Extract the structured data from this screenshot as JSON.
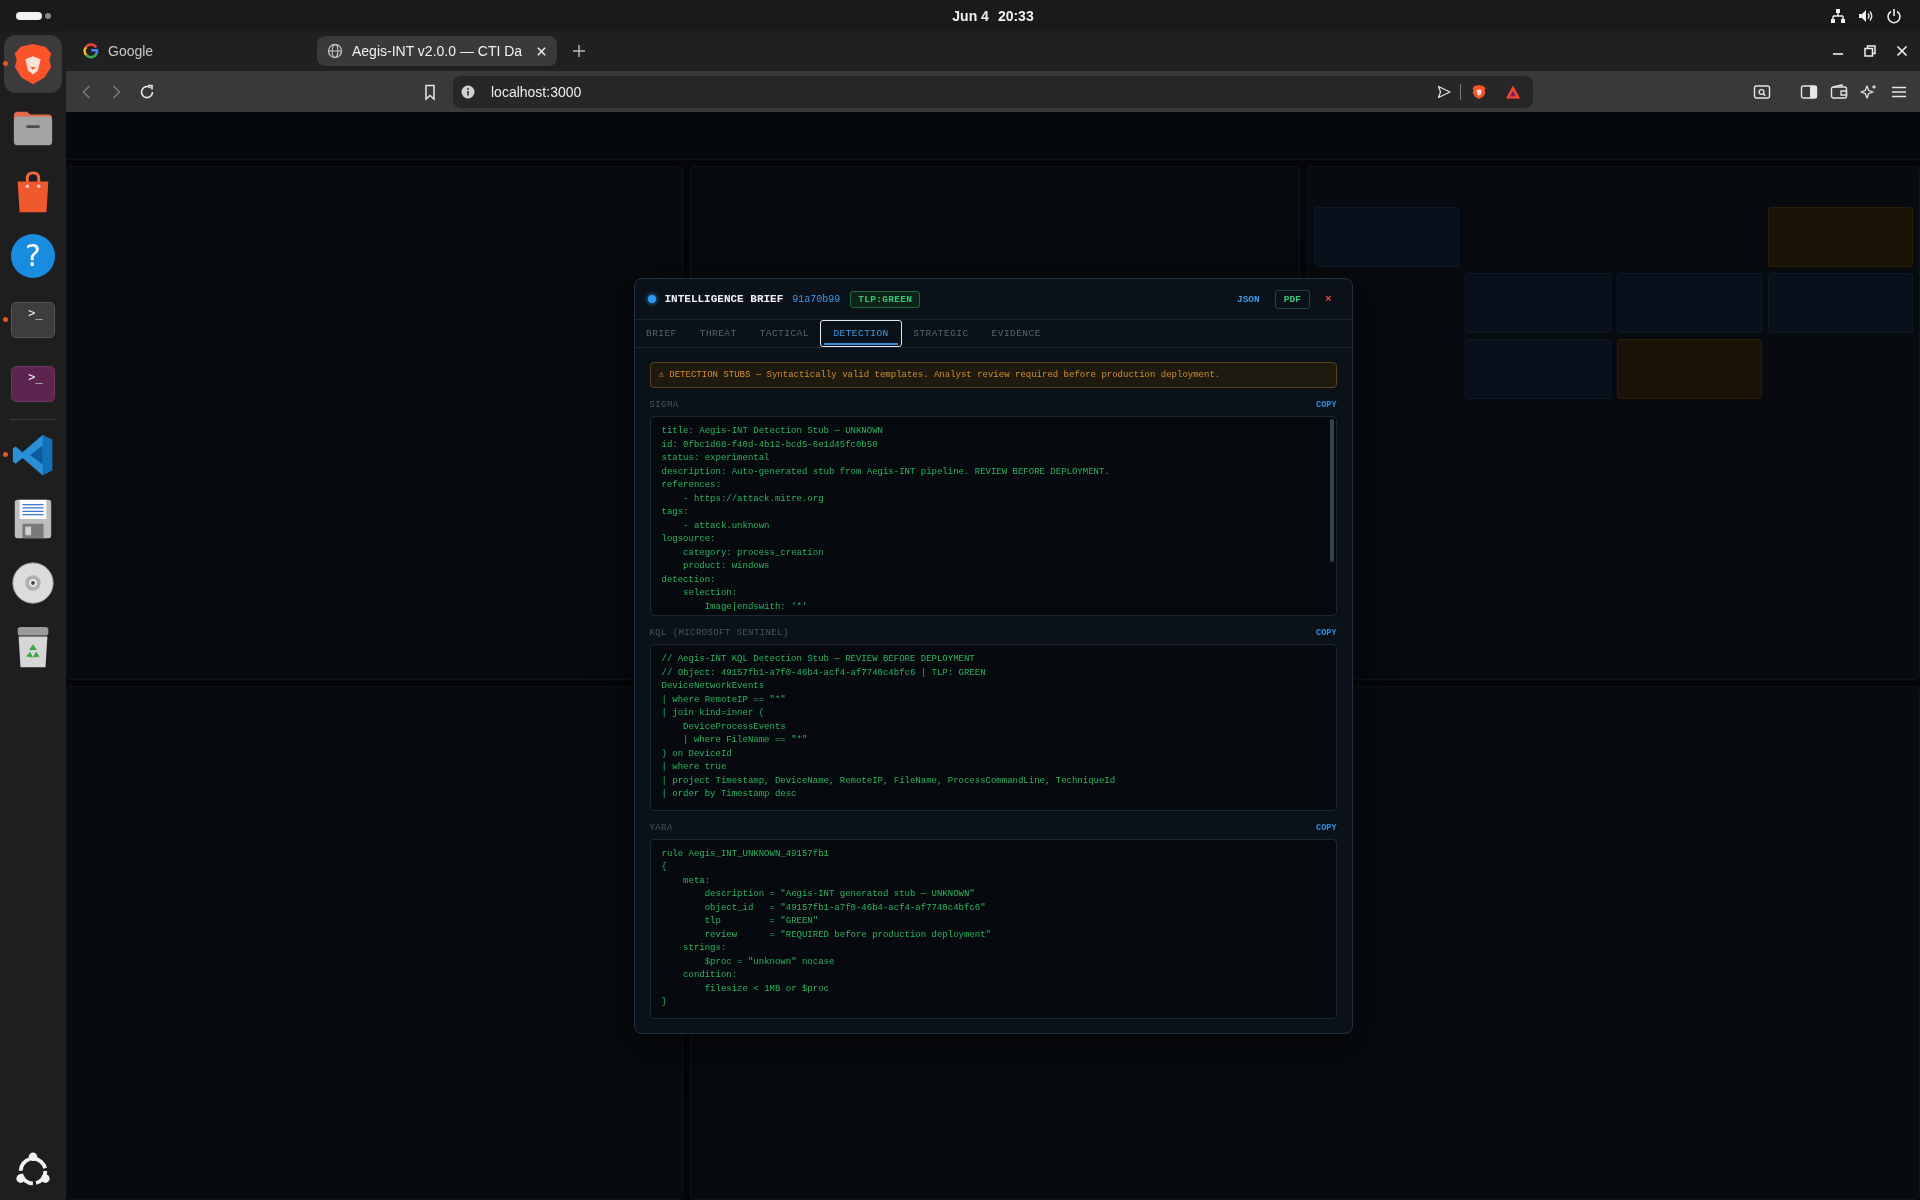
{
  "system_bar": {
    "date": "Jun 4",
    "time": "20:33"
  },
  "dock": {
    "favorites": [
      {
        "kind": "shield",
        "selected": true,
        "running": true
      },
      {
        "kind": "folder",
        "selected": false,
        "running": false
      },
      {
        "kind": "bag",
        "selected": false,
        "running": false
      },
      {
        "kind": "help",
        "glyph": "?",
        "selected": false,
        "running": false
      },
      {
        "kind": "terminal",
        "glyph": ">_",
        "selected": false,
        "running": true
      },
      {
        "kind": "console",
        "glyph": ">_",
        "selected": false,
        "running": false
      }
    ],
    "others": [
      {
        "kind": "ribbon",
        "selected": false,
        "running": true
      },
      {
        "kind": "floppy",
        "selected": false,
        "running": false
      },
      {
        "kind": "disc",
        "selected": false,
        "running": false
      },
      {
        "kind": "trash",
        "selected": false,
        "running": false
      }
    ]
  },
  "browser": {
    "tabs": [
      {
        "kind": "ring",
        "title": "Google",
        "selected": false
      },
      {
        "kind": "globe",
        "title": "Aegis-INT v2.0.0 — CTI Da",
        "selected": true
      }
    ],
    "address": "localhost:3000"
  },
  "brief": {
    "title": "INTELLIGENCE BRIEF",
    "object_id": "91a70b99",
    "tlp": "TLP:GREEN",
    "actions": [
      {
        "kind": "link",
        "label": "JSON"
      },
      {
        "kind": "outlined",
        "label": "PDF"
      },
      {
        "kind": "close",
        "label": "×"
      }
    ],
    "tabs": [
      {
        "label": "BRIEF",
        "selected": false
      },
      {
        "label": "THREAT",
        "selected": false
      },
      {
        "label": "TACTICAL",
        "selected": false
      },
      {
        "label": "DETECTION",
        "selected": true
      },
      {
        "label": "STRATEGIC",
        "selected": false
      },
      {
        "label": "EVIDENCE",
        "selected": false
      }
    ],
    "notice": "⚠ DETECTION STUBS — Syntactically valid templates. Analyst review required before production deployment.",
    "sections": [
      {
        "label": "SIGMA",
        "action": "COPY",
        "scrollable": true,
        "lines": [
          "title: Aegis-INT Detection Stub — UNKNOWN",
          "id: 0fbc1d68-f40d-4b12-bcd5-6e1d45fc0b50",
          "status: experimental",
          "description: Auto-generated stub from Aegis-INT pipeline. REVIEW BEFORE DEPLOYMENT.",
          "references:",
          "    - https://attack.mitre.org",
          "tags:",
          "    - attack.unknown",
          "logsource:",
          "    category: process_creation",
          "    product: windows",
          "detection:",
          "    selection:",
          "        Image|endswith: '*'"
        ]
      },
      {
        "label": "KQL (MICROSOFT SENTINEL)",
        "action": "COPY",
        "scrollable": false,
        "lines": [
          "// Aegis-INT KQL Detection Stub — REVIEW BEFORE DEPLOYMENT",
          "// Object: 49157fb1-a7f0-46b4-acf4-af7740c4bfc6 | TLP: GREEN",
          "DeviceNetworkEvents",
          "| where RemoteIP == \"*\"",
          "| join kind=inner (",
          "    DeviceProcessEvents",
          "    | where FileName == \"*\"",
          ") on DeviceId",
          "| where true",
          "| project Timestamp, DeviceName, RemoteIP, FileName, ProcessCommandLine, TechniqueId",
          "| order by Timestamp desc"
        ]
      },
      {
        "label": "YARA",
        "action": "COPY",
        "scrollable": false,
        "lines": [
          "rule Aegis_INT_UNKNOWN_49157fb1",
          "{",
          "    meta:",
          "        description = \"Aegis-INT generated stub — UNKNOWN\"",
          "        object_id   = \"49157fb1-a7f0-46b4-acf4-af7740c4bfc6\"",
          "        tlp         = \"GREEN\"",
          "        review      = \"REQUIRED before production deployment\"",
          "    strings:",
          "        $proc = \"unknown\" nocase",
          "    condition:",
          "        filesize < 1MB or $proc",
          "}"
        ]
      }
    ]
  }
}
